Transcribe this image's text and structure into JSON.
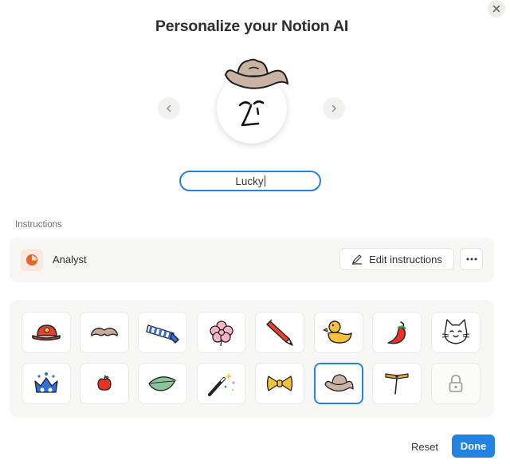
{
  "dialog": {
    "title": "Personalize your Notion AI",
    "close_icon": "close-icon"
  },
  "avatar": {
    "prev_icon": "chevron-left-icon",
    "next_icon": "chevron-right-icon",
    "face_icon": "face-icon",
    "accessory_worn": "cowboy-hat"
  },
  "name_field": {
    "value": "Lucky"
  },
  "instructions": {
    "label": "Instructions",
    "persona_name": "Analyst",
    "persona_icon": "pie-chart-icon",
    "edit_label": "Edit instructions",
    "edit_icon": "pencil-icon",
    "more_icon": "more-horizontal-icon"
  },
  "accessories": [
    {
      "name": "red-cap",
      "selected": false,
      "locked": false
    },
    {
      "name": "mustache",
      "selected": false,
      "locked": false
    },
    {
      "name": "striped-scarf",
      "selected": false,
      "locked": false
    },
    {
      "name": "pink-flower",
      "selected": false,
      "locked": false
    },
    {
      "name": "red-pencil",
      "selected": false,
      "locked": false
    },
    {
      "name": "rubber-duck",
      "selected": false,
      "locked": false
    },
    {
      "name": "chili-pepper",
      "selected": false,
      "locked": false
    },
    {
      "name": "cat-face",
      "selected": false,
      "locked": false
    },
    {
      "name": "blue-crown",
      "selected": false,
      "locked": false
    },
    {
      "name": "apple",
      "selected": false,
      "locked": false
    },
    {
      "name": "leaf",
      "selected": false,
      "locked": false
    },
    {
      "name": "magic-wand",
      "selected": false,
      "locked": false
    },
    {
      "name": "bow-tie",
      "selected": false,
      "locked": false
    },
    {
      "name": "cowboy-hat",
      "selected": true,
      "locked": false
    },
    {
      "name": "propeller-beanie",
      "selected": false,
      "locked": false
    },
    {
      "name": "lock",
      "selected": false,
      "locked": true
    }
  ],
  "footer": {
    "reset_label": "Reset",
    "done_label": "Done"
  },
  "colors": {
    "accent": "#2383e2",
    "persona": "#e2652a",
    "panel_bg": "#f7f7f5"
  }
}
